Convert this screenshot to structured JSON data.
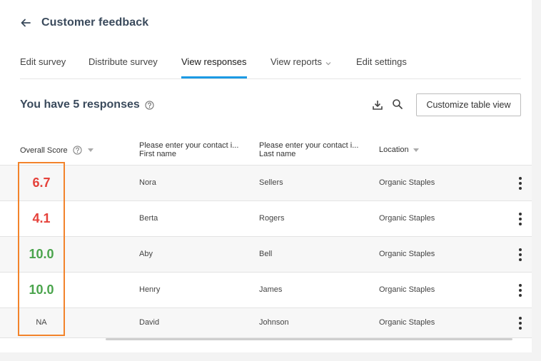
{
  "header": {
    "title": "Customer feedback"
  },
  "tabs": [
    {
      "label": "Edit survey",
      "active": false
    },
    {
      "label": "Distribute survey",
      "active": false
    },
    {
      "label": "View responses",
      "active": true
    },
    {
      "label": "View reports",
      "active": false,
      "has_dropdown": true
    },
    {
      "label": "Edit settings",
      "active": false
    }
  ],
  "responses": {
    "title": "You have 5 responses",
    "customize_label": "Customize table view"
  },
  "table": {
    "columns": {
      "score": "Overall Score",
      "first_line1": "Please enter your contact i...",
      "first_line2": "First name",
      "last_line1": "Please enter your contact i...",
      "last_line2": "Last name",
      "location": "Location"
    },
    "rows": [
      {
        "score": "6.7",
        "first": "Nora",
        "last": "Sellers",
        "location": "Organic Staples"
      },
      {
        "score": "4.1",
        "first": "Berta",
        "last": "Rogers",
        "location": "Organic Staples"
      },
      {
        "score": "10.0",
        "first": "Aby",
        "last": "Bell",
        "location": "Organic Staples"
      },
      {
        "score": "10.0",
        "first": "Henry",
        "last": "James",
        "location": "Organic Staples"
      },
      {
        "score": "NA",
        "first": "David",
        "last": "Johnson",
        "location": "Organic Staples"
      }
    ]
  },
  "colors": {
    "accent": "#1b9ae4",
    "score_low": "#e5413a",
    "score_high": "#4aa44c",
    "highlight": "#f2832b"
  },
  "icons": [
    "back-arrow-icon",
    "help-icon",
    "download-icon",
    "search-icon",
    "sort-icon",
    "chevron-down-icon",
    "more-vertical-icon"
  ]
}
